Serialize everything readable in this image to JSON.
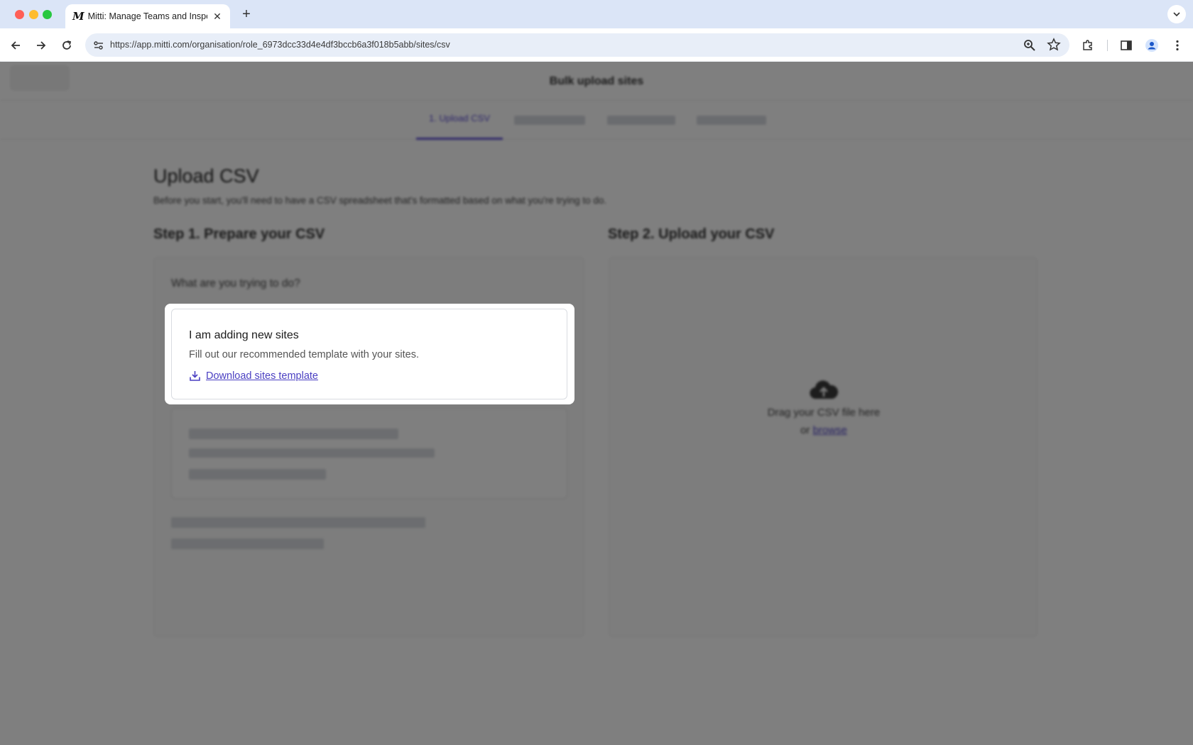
{
  "browser": {
    "tab_title": "Mitti: Manage Teams and Inspect...",
    "tab_favicon": "M",
    "url": "https://app.mitti.com/organisation/role_6973dcc33d4e4df3bccb6a3f018b5abb/sites/csv"
  },
  "page": {
    "header_title": "Bulk upload sites",
    "steps": {
      "active_label": "1. Upload CSV"
    },
    "heading": "Upload CSV",
    "subheading": "Before you start, you'll need to have a CSV spreadsheet that's formatted based on what you're trying to do.",
    "step1_title": "Step 1. Prepare your CSV",
    "step2_title": "Step 2. Upload your CSV",
    "question": "What are you trying to do?",
    "upload": {
      "drag_text": "Drag your CSV file here",
      "or_text": "or",
      "browse_label": "browse"
    }
  },
  "highlight": {
    "title": "I am adding new sites",
    "description": "Fill out our recommended template with your sites.",
    "download_label": "Download sites template"
  },
  "colors": {
    "accent": "#5a4bd1",
    "link": "#4a3fc2",
    "overlay": "rgba(0,0,0,0.5)"
  }
}
